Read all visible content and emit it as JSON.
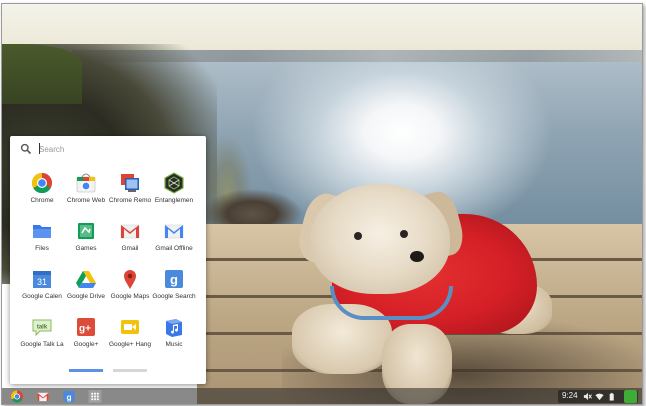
{
  "launcher": {
    "search_placeholder": "Search",
    "apps": [
      {
        "label": "Chrome",
        "icon": "chrome-icon"
      },
      {
        "label": "Chrome Web",
        "icon": "chrome-web-store-icon"
      },
      {
        "label": "Chrome Remo",
        "icon": "chrome-remote-desktop-icon"
      },
      {
        "label": "Entanglemen",
        "icon": "entanglement-icon"
      },
      {
        "label": "Files",
        "icon": "files-icon"
      },
      {
        "label": "Games",
        "icon": "games-icon"
      },
      {
        "label": "Gmail",
        "icon": "gmail-icon"
      },
      {
        "label": "Gmail Offline",
        "icon": "gmail-offline-icon"
      },
      {
        "label": "Google Calen",
        "icon": "google-calendar-icon"
      },
      {
        "label": "Google Drive",
        "icon": "google-drive-icon"
      },
      {
        "label": "Google Maps",
        "icon": "google-maps-icon"
      },
      {
        "label": "Google Search",
        "icon": "google-search-icon"
      },
      {
        "label": "Google Talk La",
        "icon": "google-talk-icon"
      },
      {
        "label": "Google+",
        "icon": "google-plus-icon"
      },
      {
        "label": "Google+ Hang",
        "icon": "google-hangouts-icon"
      },
      {
        "label": "Music",
        "icon": "music-icon"
      }
    ],
    "pages": {
      "current": 1,
      "total": 2
    }
  },
  "shelf": {
    "items": [
      {
        "name": "chrome",
        "icon": "chrome-icon"
      },
      {
        "name": "gmail",
        "icon": "gmail-icon"
      },
      {
        "name": "google-search",
        "icon": "google-search-icon"
      },
      {
        "name": "app-launcher",
        "icon": "app-launcher-icon"
      }
    ],
    "tray": {
      "time": "9:24",
      "icons": [
        "volume-muted-icon",
        "wifi-icon",
        "battery-icon"
      ]
    }
  },
  "colors": {
    "accent": "#5b92e5",
    "chrome_red": "#db4437",
    "chrome_yellow": "#f4c20d",
    "chrome_green": "#0f9d58",
    "chrome_blue": "#4285f4"
  }
}
